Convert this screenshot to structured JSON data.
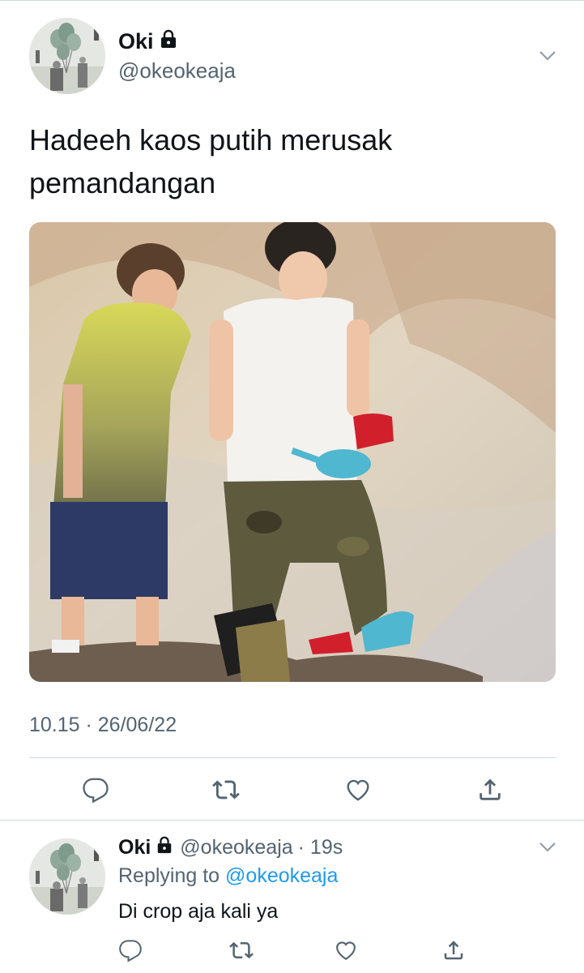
{
  "main_tweet": {
    "author": {
      "name": "Oki",
      "handle": "@okeokeaja"
    },
    "text": "Hadeeh kaos putih merusak pemandangan",
    "timestamp": "10.15 · 26/06/22"
  },
  "reply_tweet": {
    "author": {
      "name": "Oki",
      "handle": "@okeokeaja"
    },
    "time": "· 19s",
    "replying_label": "Replying to",
    "replying_to": "@okeokeaja",
    "text": "Di crop aja kali ya"
  },
  "icons": {
    "lock": "lock-icon",
    "more": "chevron-down-icon",
    "reply": "reply-icon",
    "retweet": "retweet-icon",
    "like": "like-icon",
    "share": "share-icon"
  },
  "colors": {
    "text": "#0f1419",
    "secondary": "#536471",
    "link": "#1d9bf0",
    "divider": "#cfd9de"
  }
}
